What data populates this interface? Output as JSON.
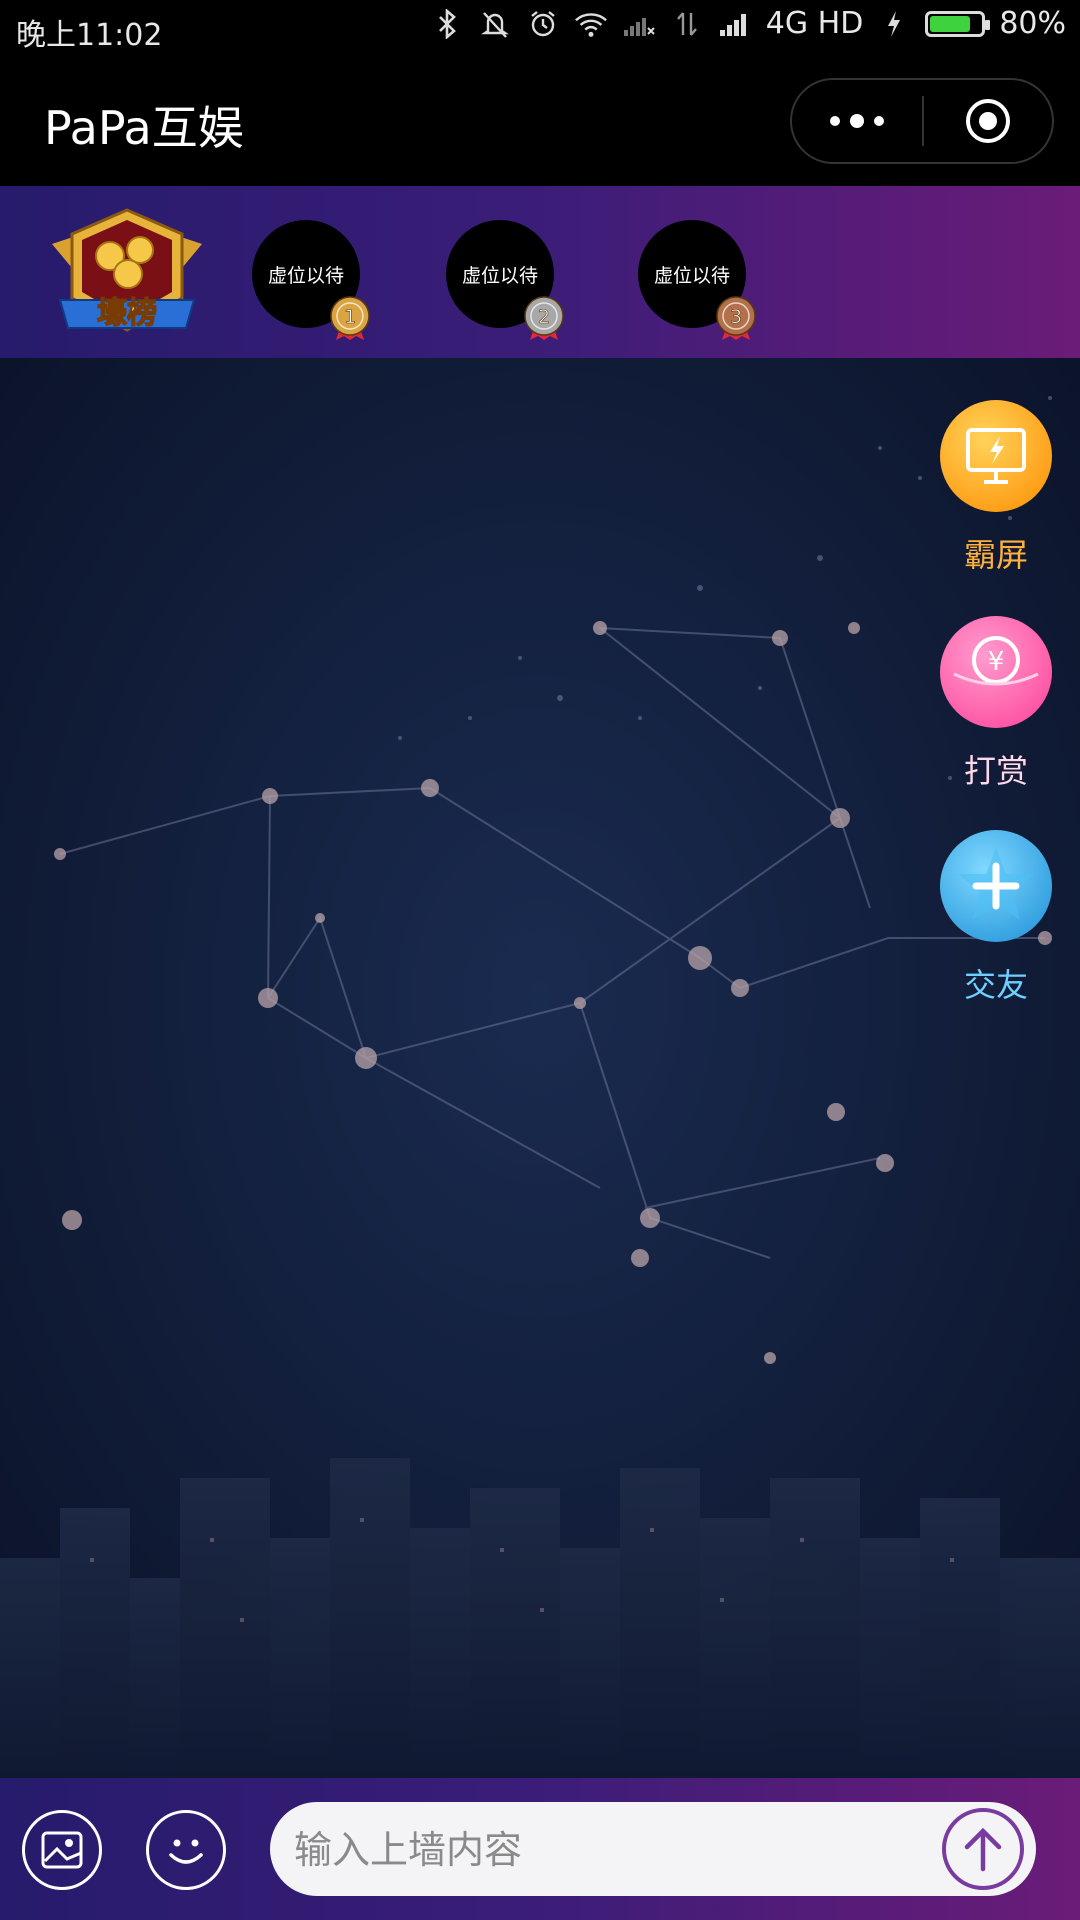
{
  "status_bar": {
    "time": "晚上11:02",
    "network": "4G HD",
    "battery": "80%",
    "battery_level": 0.8,
    "icons": [
      "bluetooth-icon",
      "mute-icon",
      "alarm-icon",
      "wifi-icon",
      "signal-x-icon",
      "data-arrows-icon",
      "signal-icon",
      "charging-icon",
      "battery-icon"
    ]
  },
  "title_bar": {
    "title": "PaPa互娱",
    "icons": [
      "more-dots-icon",
      "close-target-icon"
    ]
  },
  "ranking": {
    "badge_text": "壕榜",
    "slots": [
      {
        "label": "虚位以待",
        "rank": "1",
        "medal_color": "#d9a441"
      },
      {
        "label": "虚位以待",
        "rank": "2",
        "medal_color": "#a8a8a8"
      },
      {
        "label": "虚位以待",
        "rank": "3",
        "medal_color": "#b3704a"
      }
    ]
  },
  "actions": [
    {
      "label": "霸屏",
      "color": "#ffa31a",
      "label_color": "#ffb13b",
      "icon": "monitor-lightning-icon"
    },
    {
      "label": "打赏",
      "color": "#ff5aa8",
      "label_color": "#ffd9ea",
      "icon": "coin-yen-icon"
    },
    {
      "label": "交友",
      "color": "#2fa7e6",
      "label_color": "#6fd0ff",
      "icon": "star-plus-icon"
    }
  ],
  "bottom_bar": {
    "image_icon": "image-icon",
    "emoji_icon": "smile-icon",
    "input_placeholder": "输入上墙内容",
    "send_icon": "arrow-up-icon"
  }
}
